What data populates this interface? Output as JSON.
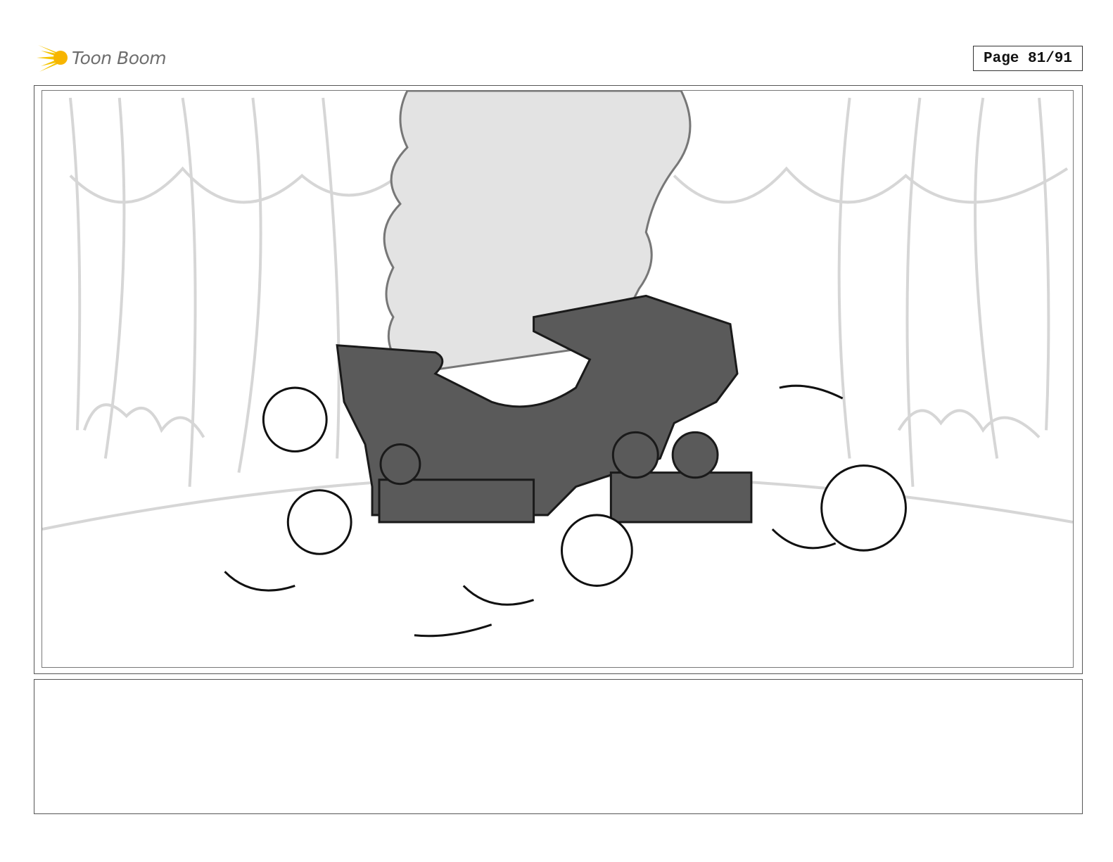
{
  "header": {
    "logo_text": "Toon Boom",
    "page_label": "Page 81/91"
  },
  "panel": {
    "icon": "storyboard-sketch"
  },
  "notes": {
    "text": ""
  },
  "colors": {
    "logo_yellow": "#f5c400",
    "logo_text": "#6e6e6e",
    "frame": "#555555",
    "machine_fill": "#5a5a5a",
    "smoke_fill": "#e3e3e3",
    "curtain_lines": "#d6d6d6"
  }
}
